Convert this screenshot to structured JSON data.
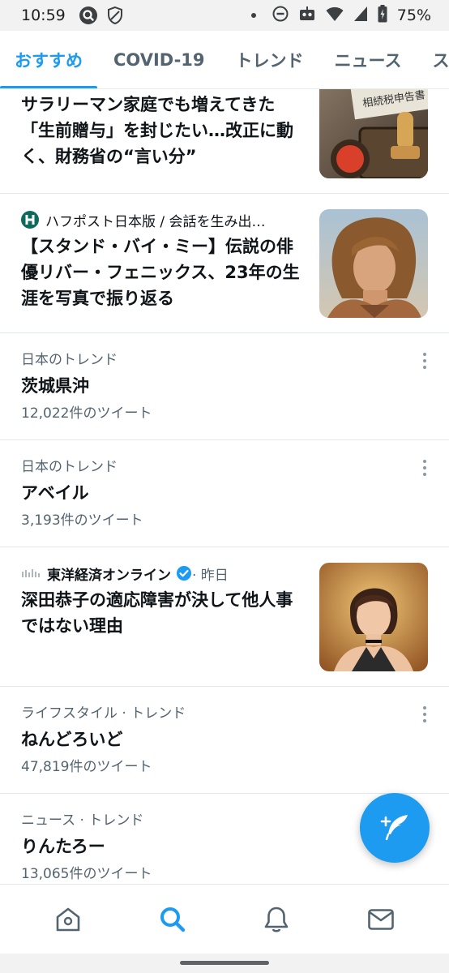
{
  "status_bar": {
    "time": "10:59",
    "battery": "75%",
    "icons": [
      "search-badge-icon",
      "shield-icon",
      "dot-icon",
      "do-not-disturb-icon",
      "robot-icon",
      "wifi-icon",
      "signal-icon",
      "battery-charging-icon"
    ]
  },
  "tabs": [
    {
      "label": "おすすめ",
      "active": true
    },
    {
      "label": "COVID-19",
      "active": false
    },
    {
      "label": "トレンド",
      "active": false
    },
    {
      "label": "ニュース",
      "active": false
    },
    {
      "label": "ス",
      "active": false
    }
  ],
  "feed": {
    "news1": {
      "title": "サラリーマン家庭でも増えてきた「生前贈与」を封じたい…改正に動く、財務省の“言い分”",
      "image_text": "相続税申告書"
    },
    "news2": {
      "source": "ハフポスト日本版 / 会話を生み出…",
      "title": "【スタンド・バイ・ミー】伝説の俳優リバー・フェニックス、23年の生涯を写真で振り返る"
    },
    "trend1": {
      "category": "日本のトレンド",
      "name": "茨城県沖",
      "count": "12,022件のツイート"
    },
    "trend2": {
      "category": "日本のトレンド",
      "name": "アベイル",
      "count": "3,193件のツイート"
    },
    "news3": {
      "source": "東洋経済オンライン",
      "time": " · 昨日",
      "title": "深田恭子の適応障害が決して他人事ではない理由"
    },
    "trend3": {
      "category": "ライフスタイル · トレンド",
      "name": "ねんどろいど",
      "count": "47,819件のツイート"
    },
    "trend4": {
      "category": "ニュース · トレンド",
      "name": "りんたろー",
      "count": "13,065件のツイート"
    }
  },
  "colors": {
    "accent": "#1d9bf0",
    "text": "#0f1419",
    "secondary": "#536471"
  },
  "fab_icon": "compose-tweet-icon",
  "bottom_nav": [
    "home-icon",
    "search-icon",
    "notifications-icon",
    "messages-icon"
  ]
}
